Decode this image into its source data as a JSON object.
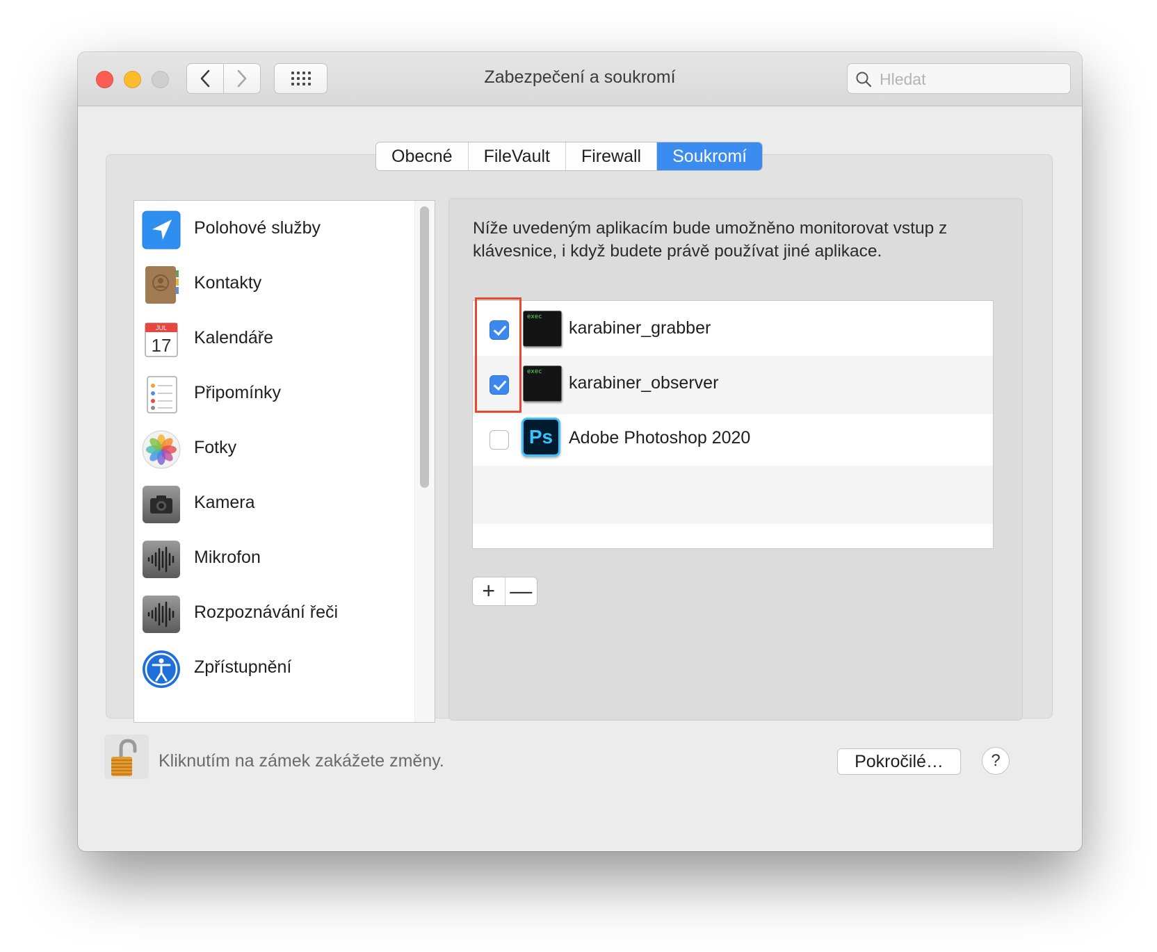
{
  "window": {
    "title": "Zabezpečení a soukromí",
    "search_placeholder": "Hledat"
  },
  "tabs": [
    {
      "label": "Obecné",
      "active": false
    },
    {
      "label": "FileVault",
      "active": false
    },
    {
      "label": "Firewall",
      "active": false
    },
    {
      "label": "Soukromí",
      "active": true
    }
  ],
  "sidebar": {
    "items": [
      {
        "label": "Polohové služby",
        "icon": "location-arrow-icon"
      },
      {
        "label": "Kontakty",
        "icon": "contacts-book-icon"
      },
      {
        "label": "Kalendáře",
        "icon": "calendar-icon",
        "icon_month": "JUL",
        "icon_day": "17"
      },
      {
        "label": "Připomínky",
        "icon": "reminders-list-icon"
      },
      {
        "label": "Fotky",
        "icon": "photos-flower-icon"
      },
      {
        "label": "Kamera",
        "icon": "camera-icon"
      },
      {
        "label": "Mikrofon",
        "icon": "microphone-waveform-icon"
      },
      {
        "label": "Rozpoznávání řeči",
        "icon": "speech-waveform-icon"
      },
      {
        "label": "Zpřístupnění",
        "icon": "accessibility-icon"
      }
    ]
  },
  "main": {
    "description": "Níže uvedeným aplikacím bude umožněno monitorovat vstup z klávesnice, i když budete právě používat jiné aplikace.",
    "apps": [
      {
        "name": "karabiner_grabber",
        "checked": true,
        "icon": "exec-terminal-icon",
        "icon_label": "exec"
      },
      {
        "name": "karabiner_observer",
        "checked": true,
        "icon": "exec-terminal-icon",
        "icon_label": "exec"
      },
      {
        "name": "Adobe Photoshop 2020",
        "checked": false,
        "icon": "photoshop-icon",
        "icon_label": "Ps"
      }
    ],
    "add_label": "+",
    "remove_label": "—"
  },
  "footer": {
    "lock_text": "Kliknutím na zámek zakážete změny.",
    "advanced_label": "Pokročilé…",
    "help_label": "?"
  },
  "colors": {
    "accent": "#3b8cf0",
    "highlight_box": "#e64a2e"
  }
}
